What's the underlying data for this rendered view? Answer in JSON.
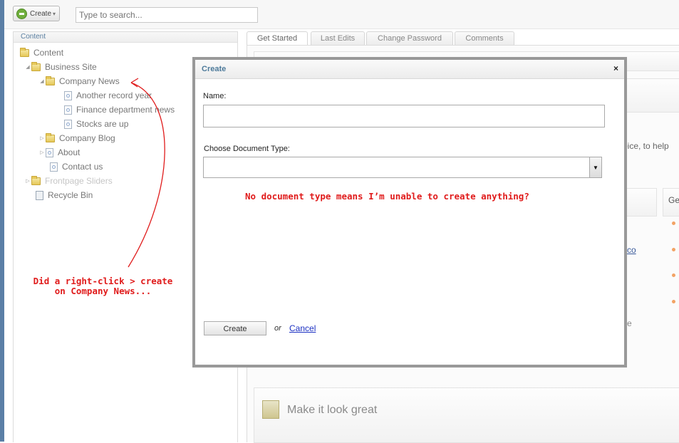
{
  "toolbar": {
    "create_label": "Create",
    "search_placeholder": "Type to search..."
  },
  "tree": {
    "header": "Content",
    "nodes": [
      {
        "label": "Content",
        "icon": "folder-icon"
      },
      {
        "label": "Business Site",
        "icon": "folder-icon"
      },
      {
        "label": "Company News",
        "icon": "folder-icon"
      },
      {
        "label": "Another record year",
        "icon": "document-icon"
      },
      {
        "label": "Finance department news",
        "icon": "document-icon"
      },
      {
        "label": "Stocks are up",
        "icon": "document-icon"
      },
      {
        "label": "Company Blog",
        "icon": "folder-icon"
      },
      {
        "label": "About",
        "icon": "document-icon"
      },
      {
        "label": "Contact us",
        "icon": "document-icon"
      },
      {
        "label": "Frontpage Sliders",
        "icon": "folder-icon"
      },
      {
        "label": "Recycle Bin",
        "icon": "recycle-bin-icon"
      }
    ]
  },
  "tabs": [
    {
      "label": "Get Started",
      "active": true
    },
    {
      "label": "Last Edits",
      "active": false
    },
    {
      "label": "Change Password",
      "active": false
    },
    {
      "label": "Comments",
      "active": false
    }
  ],
  "background": {
    "partial_text_1": "oice, to help",
    "partial_text_2": "Ge",
    "link_fragment": "co",
    "text_fragment_e": "e",
    "section_title": "Make it look great",
    "colors": {
      "bullet": "#f2a365"
    }
  },
  "dialog": {
    "title": "Create",
    "close_glyph": "×",
    "name_label": "Name:",
    "name_value": "",
    "doctype_label": "Choose Document Type:",
    "doctype_value": "",
    "create_button": "Create",
    "or_text": "or",
    "cancel_link": "Cancel"
  },
  "annotations": {
    "dialog_note": "No document type means I’m unable to create anything?",
    "tree_note_line1": "Did a right-click > create",
    "tree_note_line2": "on Company News...",
    "color": "#e01b1b"
  }
}
